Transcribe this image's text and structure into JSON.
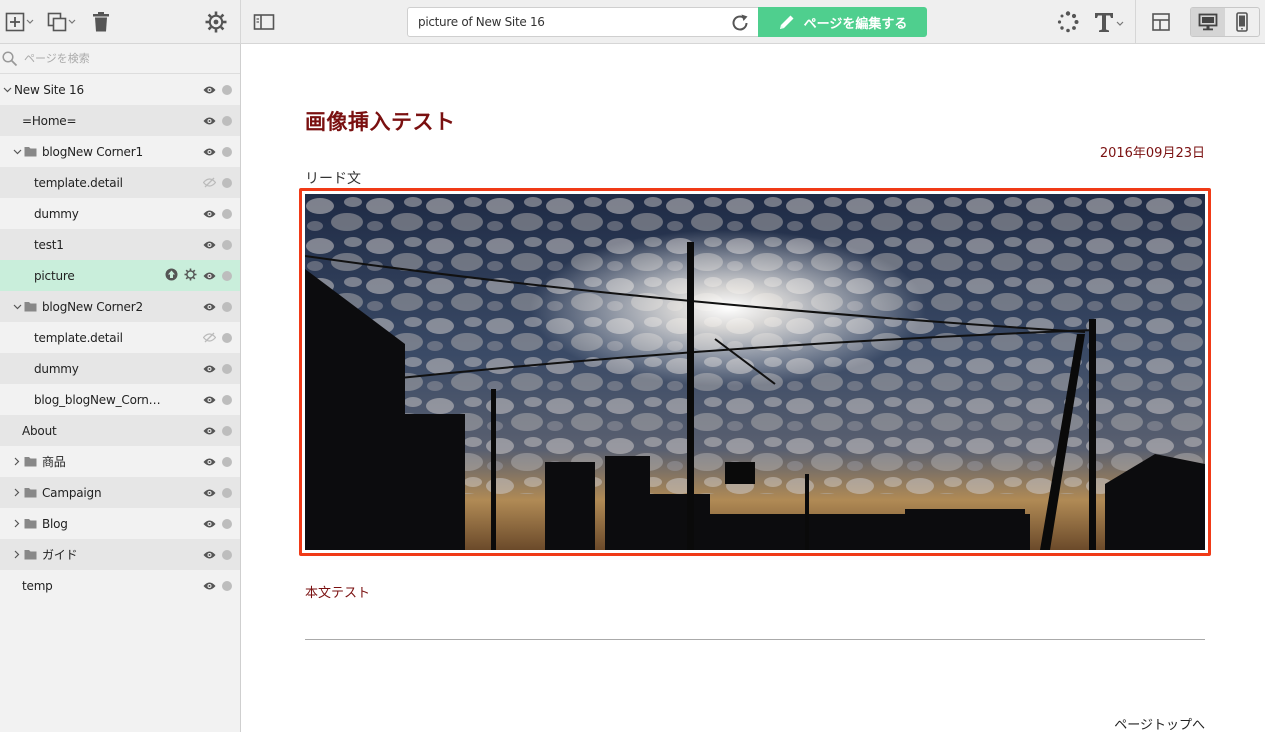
{
  "toolbar": {
    "url": "picture of New Site 16",
    "edit_button": "ページを編集する"
  },
  "sidebar": {
    "search_placeholder": "ページを検索",
    "items": [
      {
        "label": "New Site 16"
      },
      {
        "label": "=Home="
      },
      {
        "label": "blogNew Corner1"
      },
      {
        "label": "template.detail"
      },
      {
        "label": "dummy"
      },
      {
        "label": "test1"
      },
      {
        "label": "picture"
      },
      {
        "label": "blogNew Corner2"
      },
      {
        "label": "template.detail"
      },
      {
        "label": "dummy"
      },
      {
        "label": "blog_blogNew_Corn…"
      },
      {
        "label": "About"
      },
      {
        "label": "商品"
      },
      {
        "label": "Campaign"
      },
      {
        "label": "Blog"
      },
      {
        "label": "ガイド"
      },
      {
        "label": "temp"
      }
    ]
  },
  "page": {
    "title": "画像挿入テスト",
    "date": "2016年09月23日",
    "lead": "リード文",
    "body": "本文テスト",
    "to_top": "ページトップへ"
  },
  "colors": {
    "accent_green": "#4fcf8e",
    "title_red": "#7a1010",
    "image_border": "#f03a17",
    "selected_row": "#c9eedb"
  }
}
